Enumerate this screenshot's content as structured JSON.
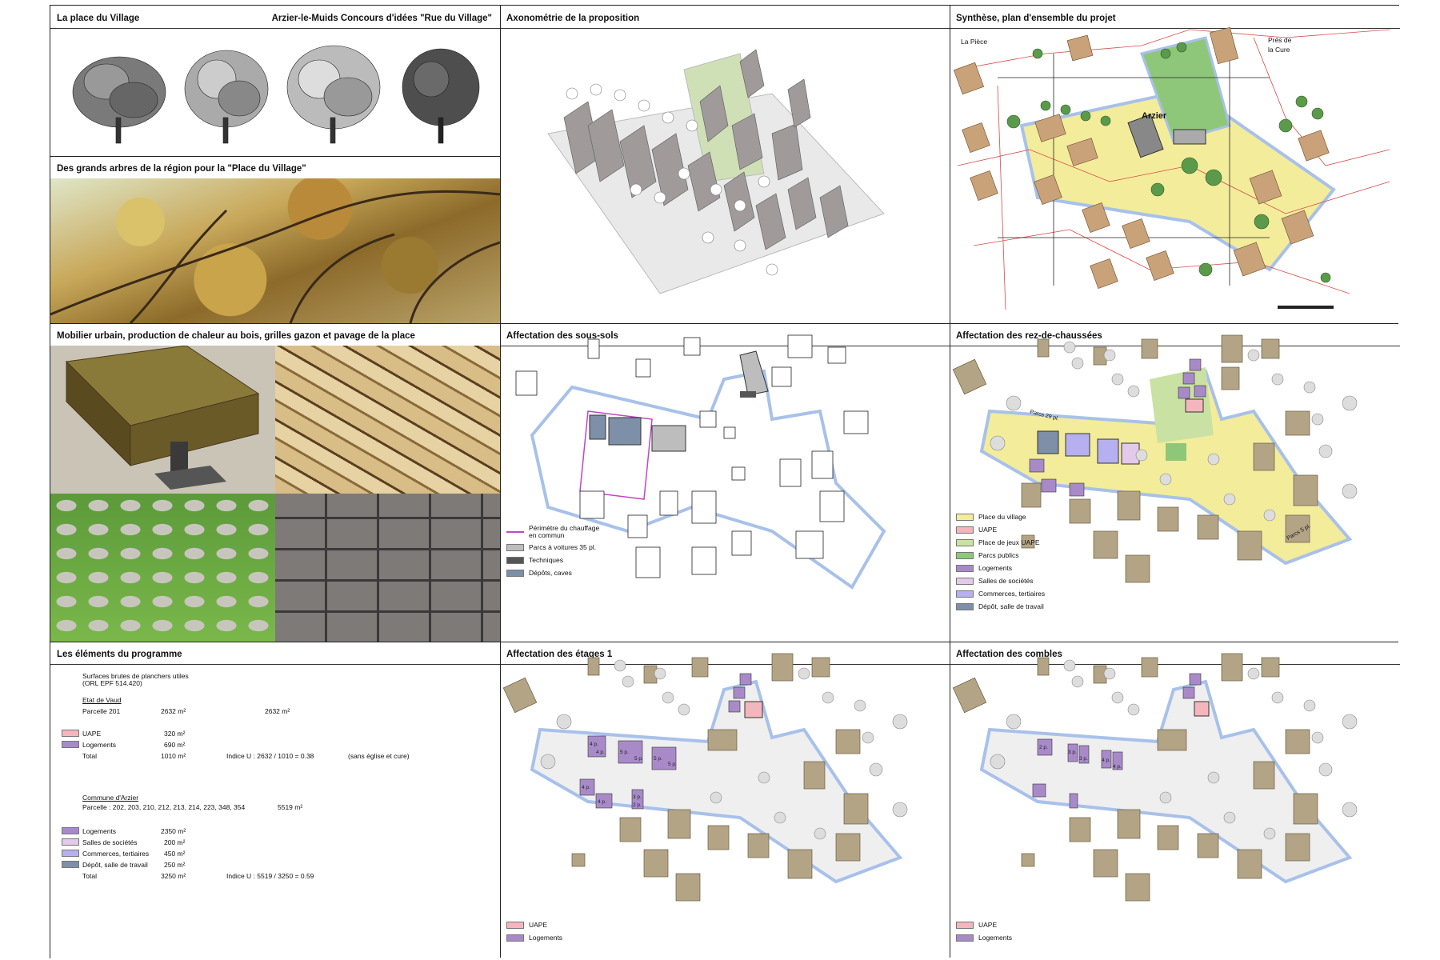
{
  "colors": {
    "place_du_village": "#f3ec9b",
    "uape": "#f4b6bd",
    "place_de_jeux_uape": "#c9e2a3",
    "parcs_publics": "#8fc77a",
    "logements": "#a88ac9",
    "salles_de_societes": "#e3c9ea",
    "commerces_tertiaires": "#b6b0f1",
    "depot_salle_de_travail": "#7e8fa8",
    "building_brown": "#c9a27a",
    "building_khaki": "#b3a486",
    "perimeter_blue": "#a8c1ea",
    "chauffage_magenta": "#c046c6"
  },
  "panels": {
    "place_village": {
      "title_left": "La place du Village",
      "title_right": "Arzier-le-Muids Concours d'idées \"Rue du Village\""
    },
    "axonometrie": {
      "title": "Axonométrie de la proposition"
    },
    "synthese": {
      "title": "Synthèse, plan d'ensemble du projet",
      "label_piece": "La Pièce",
      "label_pres_1": "Prés de",
      "label_pres_2": "la Cure",
      "label_arzier": "Arzier"
    },
    "grands_arbres": {
      "title": "Des grands arbres de la région pour la \"Place du Village\""
    },
    "mobilier": {
      "title": "Mobilier urbain, production de chaleur au bois, grilles gazon et pavage de la place"
    },
    "sous_sols": {
      "title": "Affectation des sous-sols",
      "legend": [
        {
          "label": "Périmètre du chauffage en commun"
        },
        {
          "label": "Parcs à voitures 35 pl."
        },
        {
          "label": "Techniques"
        },
        {
          "label": "Dépôts, caves"
        }
      ]
    },
    "rez": {
      "title": "Affectation des rez-de-chaussées",
      "label_parcs": "Parcs 29 pl.",
      "label_parcs2": "Parcs 5 pl.",
      "legend": [
        {
          "label": "Place du village"
        },
        {
          "label": "UAPE"
        },
        {
          "label": "Place de jeux UAPE"
        },
        {
          "label": "Parcs publics"
        },
        {
          "label": "Logements"
        },
        {
          "label": "Salles de sociétés"
        },
        {
          "label": "Commerces, tertiaires"
        },
        {
          "label": "Dépôt, salle de travail"
        }
      ]
    },
    "programme": {
      "title": "Les éléments du programme",
      "heading_1": "Surfaces brutes de planchers utiles",
      "heading_2": "(ORL EPF 514.420)",
      "etat_title": "Etat de Vaud",
      "parcelle_201": "Parcelle 201",
      "parcelle_201_area": "2632 m²",
      "parcelle_201_area2": "2632 m²",
      "etat_rows": [
        {
          "label": "UAPE",
          "value": "320 m²"
        },
        {
          "label": "Logements",
          "value": "690 m²"
        }
      ],
      "etat_total_label": "Total",
      "etat_total_value": "1010 m²",
      "etat_indice": "Indice U :  2632 / 1010 = 0.38",
      "etat_note": "(sans église et cure)",
      "commune_title": "Commune d'Arzier",
      "commune_parcelles": "Parcelle : 202, 203, 210, 212, 213, 214, 223, 348, 354",
      "commune_area": "5519 m²",
      "commune_rows": [
        {
          "label": "Logements",
          "value": "2350 m²"
        },
        {
          "label": "Salles de sociétés",
          "value": "200 m²"
        },
        {
          "label": "Commerces, tertiaires",
          "value": "450 m²"
        },
        {
          "label": "Dépôt, salle de travail",
          "value": "250 m²"
        }
      ],
      "commune_total_label": "Total",
      "commune_total_value": "3250 m²",
      "commune_indice": "Indice U :  5519 / 3250 = 0.59"
    },
    "etages": {
      "title": "Affectation des étages 1",
      "unit_labels": [
        "4 p.",
        "4 p.",
        "5 p.",
        "5 p.",
        "5 p.",
        "5 p.",
        "4 p.",
        "4 p.",
        "3 p.",
        "2 p."
      ],
      "legend": [
        {
          "label": "UAPE"
        },
        {
          "label": "Logements"
        }
      ]
    },
    "combles": {
      "title": "Affectation des combles",
      "unit_labels": [
        "2 p.",
        "3 p.",
        "3 p.",
        "4 p.",
        "4 p."
      ],
      "legend": [
        {
          "label": "UAPE"
        },
        {
          "label": "Logements"
        }
      ]
    }
  }
}
